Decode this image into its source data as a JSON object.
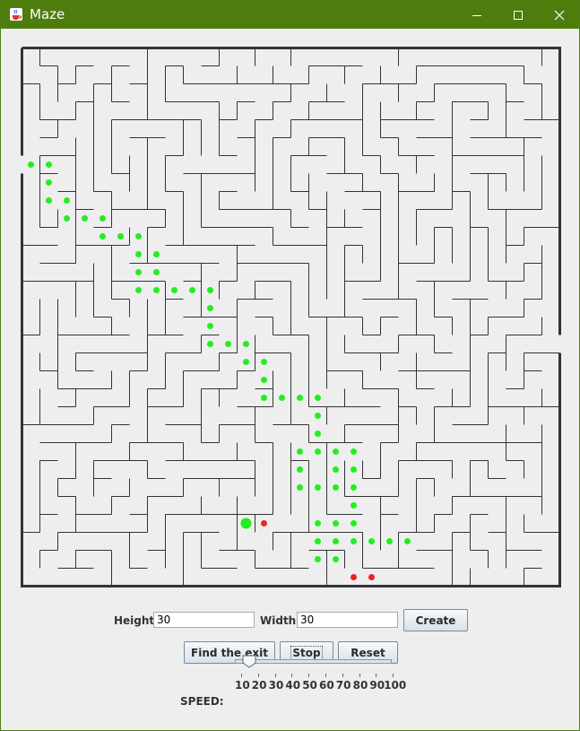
{
  "window": {
    "title": "Maze",
    "accent": "#4e7d0e",
    "controls": {
      "minimize_icon": "minimize-icon",
      "maximize_icon": "maximize-icon",
      "close_icon": "close-icon"
    }
  },
  "maze": {
    "rows": 30,
    "cols": 30,
    "wall_color": "#333333",
    "path_color": "#22ee22",
    "dead_end_color": "#ee2222",
    "path_cells": [
      [
        0,
        6
      ],
      [
        1,
        6
      ],
      [
        1,
        7
      ],
      [
        1,
        8
      ],
      [
        2,
        8
      ],
      [
        2,
        9
      ],
      [
        3,
        9
      ],
      [
        4,
        9
      ],
      [
        4,
        10
      ],
      [
        5,
        10
      ],
      [
        6,
        10
      ],
      [
        6,
        11
      ],
      [
        7,
        11
      ],
      [
        7,
        12
      ],
      [
        6,
        12
      ],
      [
        6,
        13
      ],
      [
        7,
        13
      ],
      [
        8,
        13
      ],
      [
        9,
        13
      ],
      [
        10,
        13
      ],
      [
        10,
        14
      ],
      [
        10,
        15
      ],
      [
        10,
        16
      ],
      [
        11,
        16
      ],
      [
        12,
        16
      ],
      [
        12,
        17
      ],
      [
        13,
        17
      ],
      [
        13,
        18
      ],
      [
        13,
        19
      ],
      [
        14,
        19
      ],
      [
        15,
        19
      ],
      [
        16,
        19
      ],
      [
        16,
        20
      ],
      [
        16,
        21
      ],
      [
        16,
        22
      ],
      [
        15,
        22
      ],
      [
        15,
        23
      ],
      [
        15,
        24
      ],
      [
        16,
        24
      ],
      [
        17,
        24
      ],
      [
        17,
        23
      ],
      [
        17,
        22
      ],
      [
        18,
        22
      ],
      [
        18,
        23
      ],
      [
        18,
        24
      ],
      [
        18,
        25
      ],
      [
        18,
        26
      ],
      [
        17,
        26
      ],
      [
        16,
        26
      ],
      [
        16,
        27
      ],
      [
        16,
        28
      ],
      [
        17,
        28
      ],
      [
        17,
        27
      ],
      [
        18,
        27
      ],
      [
        19,
        27
      ],
      [
        20,
        27
      ],
      [
        21,
        27
      ]
    ],
    "current_cell": [
      12,
      26
    ],
    "dead_end_cells": [
      [
        13,
        26
      ],
      [
        18,
        29
      ],
      [
        19,
        29
      ]
    ]
  },
  "controls": {
    "height_label": "Height:",
    "height_value": "30",
    "width_label": "Width:",
    "width_value": "30",
    "create_label": "Create",
    "find_label": "Find the exit",
    "stop_label": "Stop",
    "reset_label": "Reset",
    "speed_label": "SPEED:",
    "speed_value": 15,
    "speed_ticks": [
      "10",
      "20",
      "30",
      "40",
      "50",
      "60",
      "70",
      "80",
      "90",
      "100"
    ]
  }
}
